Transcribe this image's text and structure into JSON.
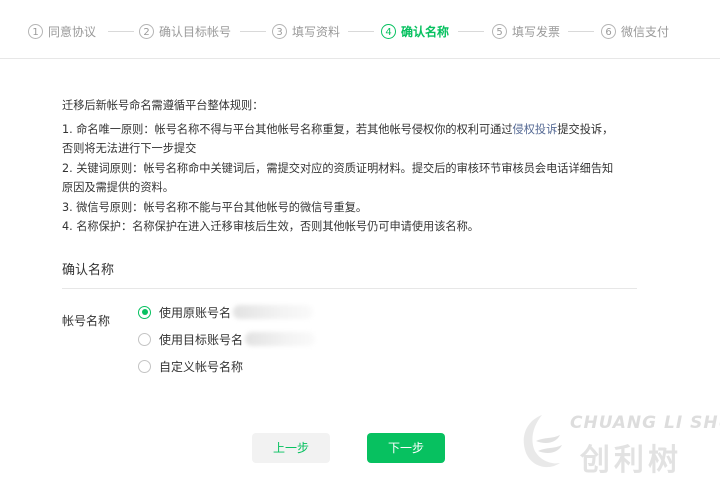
{
  "steps": [
    {
      "num": "1",
      "label": "同意协议"
    },
    {
      "num": "2",
      "label": "确认目标帐号"
    },
    {
      "num": "3",
      "label": "填写资料"
    },
    {
      "num": "4",
      "label": "确认名称"
    },
    {
      "num": "5",
      "label": "填写发票"
    },
    {
      "num": "6",
      "label": "微信支付"
    }
  ],
  "rules": {
    "intro": "迁移后新帐号命名需遵循平台整体规则：",
    "r1_a": "1. 命名唯一原则：帐号名称不得与平台其他帐号名称重复，若其他帐号侵权你的权利可通过",
    "r1_link": "侵权投诉",
    "r1_b": "提交投诉，",
    "r1_c": "否则将无法进行下一步提交",
    "r2_a": "2. 关键词原则：帐号名称命中关键词后，需提交对应的资质证明材料。提交后的审核环节审核员会电话详细告知",
    "r2_b": "原因及需提供的资料。",
    "r3": "3. 微信号原则：帐号名称不能与平台其他帐号的微信号重复。",
    "r4": "4. 名称保护：名称保护在进入迁移审核后生效，否则其他帐号仍可申请使用该名称。"
  },
  "section_title": "确认名称",
  "field_label": "帐号名称",
  "options": [
    {
      "label": "使用原账号名",
      "checked": true
    },
    {
      "label": "使用目标账号名",
      "checked": false
    },
    {
      "label": "自定义帐号名称",
      "checked": false
    }
  ],
  "buttons": {
    "prev": "上一步",
    "next": "下一步"
  },
  "watermark": {
    "en": "CHUANG LI SHU",
    "cn": "创利树"
  },
  "colors": {
    "accent": "#07c160",
    "link": "#576b95"
  }
}
